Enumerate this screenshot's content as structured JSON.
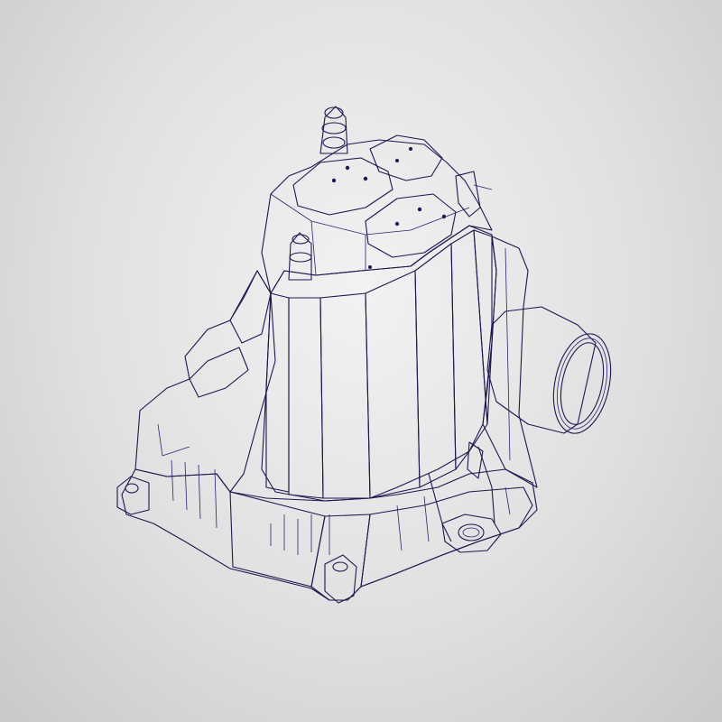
{
  "viewport": {
    "background_colors": [
      "#f2f2f2",
      "#c9c9c9"
    ]
  },
  "model": {
    "icon": "cad-housing-icon",
    "colors": {
      "face_light": "#7a72f0",
      "face_mid": "#5f56e6",
      "face_dark": "#4a40cf",
      "face_shadow": "#3a31b5",
      "edge": "#1c1850"
    }
  }
}
